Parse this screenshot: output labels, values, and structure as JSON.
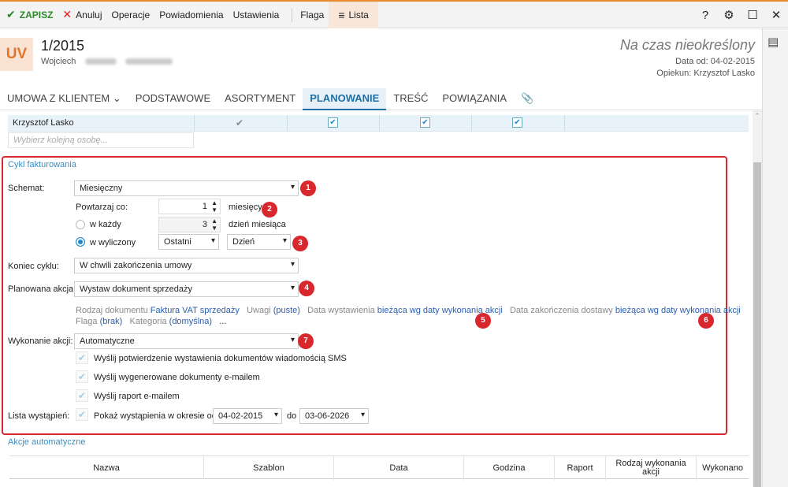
{
  "toolbar": {
    "save": "ZAPISZ",
    "cancel": "Anuluj",
    "operations": "Operacje",
    "notifications": "Powiadomienia",
    "settings": "Ustawienia",
    "flag": "Flaga",
    "list": "Lista"
  },
  "header": {
    "badge": "UV",
    "doc_number": "1/2015",
    "client_name": "Wojciech",
    "status": "Na czas nieokreślony",
    "date_from": "Data od: 04-02-2015",
    "caretaker": "Opiekun: Krzysztof Lasko"
  },
  "tabs": [
    "UMOWA Z KLIENTEM",
    "PODSTAWOWE",
    "ASORTYMENT",
    "PLANOWANIE",
    "TREŚĆ",
    "POWIĄZANIA"
  ],
  "people": {
    "row_name": "Krzysztof Lasko",
    "input_placeholder": "Wybierz kolejną osobę..."
  },
  "billing": {
    "section_title": "Cykl fakturowania",
    "schema_label": "Schemat:",
    "schema_value": "Miesięczny",
    "repeat_label": "Powtarzaj co:",
    "repeat_value": "1",
    "repeat_unit": "miesięcy",
    "each_label": "w każdy",
    "each_value": "3",
    "each_unit": "dzień miesiąca",
    "computed_label": "w wyliczony",
    "computed_option1": "Ostatni",
    "computed_option2": "Dzień",
    "cycle_end_label": "Koniec cyklu:",
    "cycle_end_value": "W chwili zakończenia umowy",
    "planned_action_label": "Planowana akcja:",
    "planned_action_value": "Wystaw dokument sprzedaży",
    "doc_type_label": "Rodzaj dokumentu",
    "doc_type_value": "Faktura VAT sprzedaży",
    "notes_label": "Uwagi",
    "notes_value": "(puste)",
    "issue_date_label": "Data wystawienia",
    "issue_date_value": "bieżąca wg daty wykonania akcji",
    "delivery_end_label": "Data zakończenia dostawy",
    "delivery_end_value": "bieżąca wg daty wykonania akcji",
    "flag_label": "Flaga",
    "flag_value": "(brak)",
    "category_label": "Kategoria",
    "category_value": "(domyślna)",
    "more": "...",
    "execution_label": "Wykonanie akcji:",
    "execution_value": "Automatyczne",
    "chk_sms": "Wyślij potwierdzenie wystawienia dokumentów wiadomością SMS",
    "chk_email_docs": "Wyślij wygenerowane dokumenty e-mailem",
    "chk_email_report": "Wyślij raport e-mailem",
    "occurrences_label": "Lista wystąpień:",
    "show_occurrences": "Pokaż wystąpienia w okresie od",
    "date_from_value": "04-02-2015",
    "to_label": "do",
    "date_to_value": "03-06-2026"
  },
  "badges": [
    "1",
    "2",
    "3",
    "4",
    "5",
    "6",
    "7"
  ],
  "auto_actions": {
    "section_title": "Akcje automatyczne",
    "columns": [
      "Nazwa",
      "Szablon",
      "Data",
      "Godzina",
      "Raport",
      "Rodzaj wykonania akcji",
      "Wykonano"
    ]
  },
  "colors": {
    "accent": "#e8892a",
    "highlight_red": "#d9272e",
    "link_blue": "#2a5fb0",
    "tab_active": "#1d6fa8"
  }
}
